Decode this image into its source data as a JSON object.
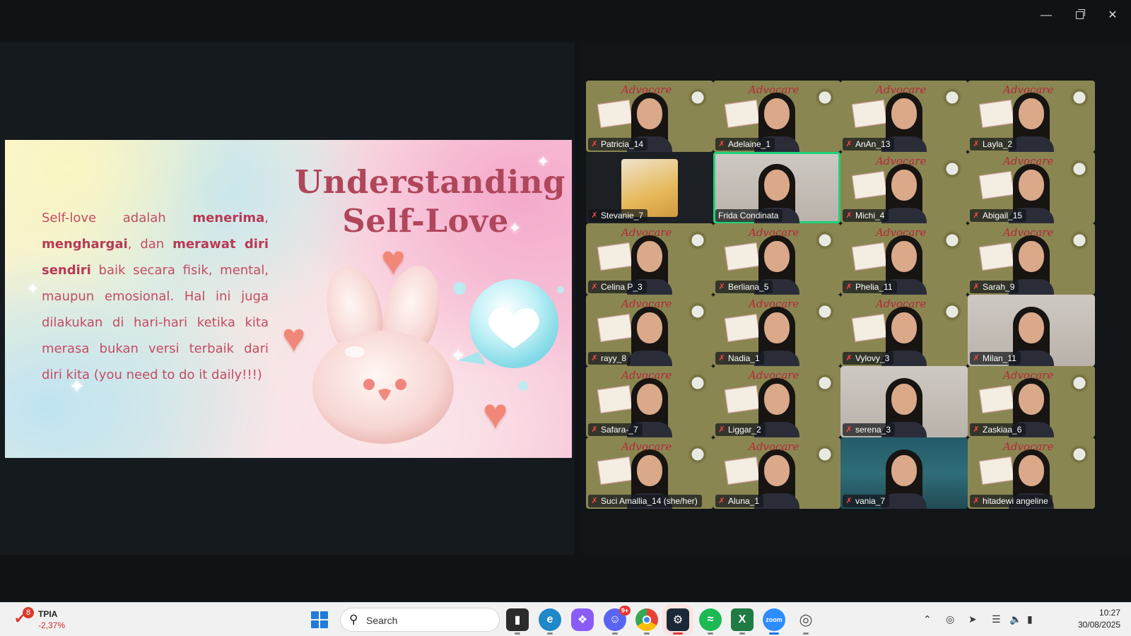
{
  "window": {
    "controls": [
      "minimize",
      "maximize",
      "close"
    ]
  },
  "slide": {
    "title_line1": "Understanding",
    "title_line2": "Self-Love",
    "body": {
      "t1": "Self-love adalah ",
      "b1": "menerima",
      "t2": ", ",
      "b2": "menghargai",
      "t3": ", dan ",
      "b3": "merawat diri sendiri",
      "t4": " baik secara fisik, mental, maupun emosional. Hal ini juga dilakukan di hari-hari ketika kita merasa bukan versi terbaik dari diri kita (you need to do it daily!!!)"
    },
    "colors": {
      "title": "#b0465b",
      "text": "#c44b62",
      "heart": "#f08777"
    }
  },
  "participants": [
    {
      "name": "Patricia_14",
      "muted": true,
      "video": "background"
    },
    {
      "name": "Adelaine_1",
      "muted": true,
      "video": "background"
    },
    {
      "name": "AnAn_13",
      "muted": true,
      "video": "background"
    },
    {
      "name": "Layla_2",
      "muted": true,
      "video": "background"
    },
    {
      "name": "Stevanie_7",
      "muted": true,
      "video": "photo"
    },
    {
      "name": "Frida Condinata",
      "muted": false,
      "video": "camera",
      "speaking": true
    },
    {
      "name": "Michi_4",
      "muted": true,
      "video": "background"
    },
    {
      "name": "Abigail_15",
      "muted": true,
      "video": "background"
    },
    {
      "name": "Celina P_3",
      "muted": true,
      "video": "background"
    },
    {
      "name": "Berliana_5",
      "muted": true,
      "video": "background"
    },
    {
      "name": "Phelia_11",
      "muted": true,
      "video": "background"
    },
    {
      "name": "Sarah_9",
      "muted": true,
      "video": "background"
    },
    {
      "name": "rayy_8",
      "muted": true,
      "video": "background"
    },
    {
      "name": "Nadia_1",
      "muted": true,
      "video": "background"
    },
    {
      "name": "Vylovy_3",
      "muted": true,
      "video": "background"
    },
    {
      "name": "Milan_11",
      "muted": true,
      "video": "camera"
    },
    {
      "name": "Safara-_7",
      "muted": true,
      "video": "background"
    },
    {
      "name": "Liggar_2",
      "muted": true,
      "video": "background"
    },
    {
      "name": "serena_3",
      "muted": true,
      "video": "camera"
    },
    {
      "name": "Zaskiaa_6",
      "muted": true,
      "video": "background"
    },
    {
      "name": "Suci Amallia_14 (she/her)",
      "muted": true,
      "video": "background"
    },
    {
      "name": "Aluna_1",
      "muted": true,
      "video": "background"
    },
    {
      "name": "vania_7",
      "muted": true,
      "video": "room"
    },
    {
      "name": "hitadewi angeline",
      "muted": true,
      "video": "background"
    }
  ],
  "taskbar": {
    "stock": {
      "badge": "8",
      "ticker": "TPIA",
      "change": "-2,37%"
    },
    "search_placeholder": "Search",
    "apps": [
      {
        "name": "file-explorer",
        "badge": ""
      },
      {
        "name": "edge",
        "badge": ""
      },
      {
        "name": "copilot",
        "badge": ""
      },
      {
        "name": "discord",
        "badge": "9+"
      },
      {
        "name": "chrome",
        "badge": ""
      },
      {
        "name": "steam",
        "badge": ""
      },
      {
        "name": "spotify",
        "badge": ""
      },
      {
        "name": "excel",
        "badge": ""
      },
      {
        "name": "zoom",
        "badge": ""
      },
      {
        "name": "other",
        "badge": ""
      }
    ],
    "time": "10:27",
    "date": "30/08/2025"
  }
}
